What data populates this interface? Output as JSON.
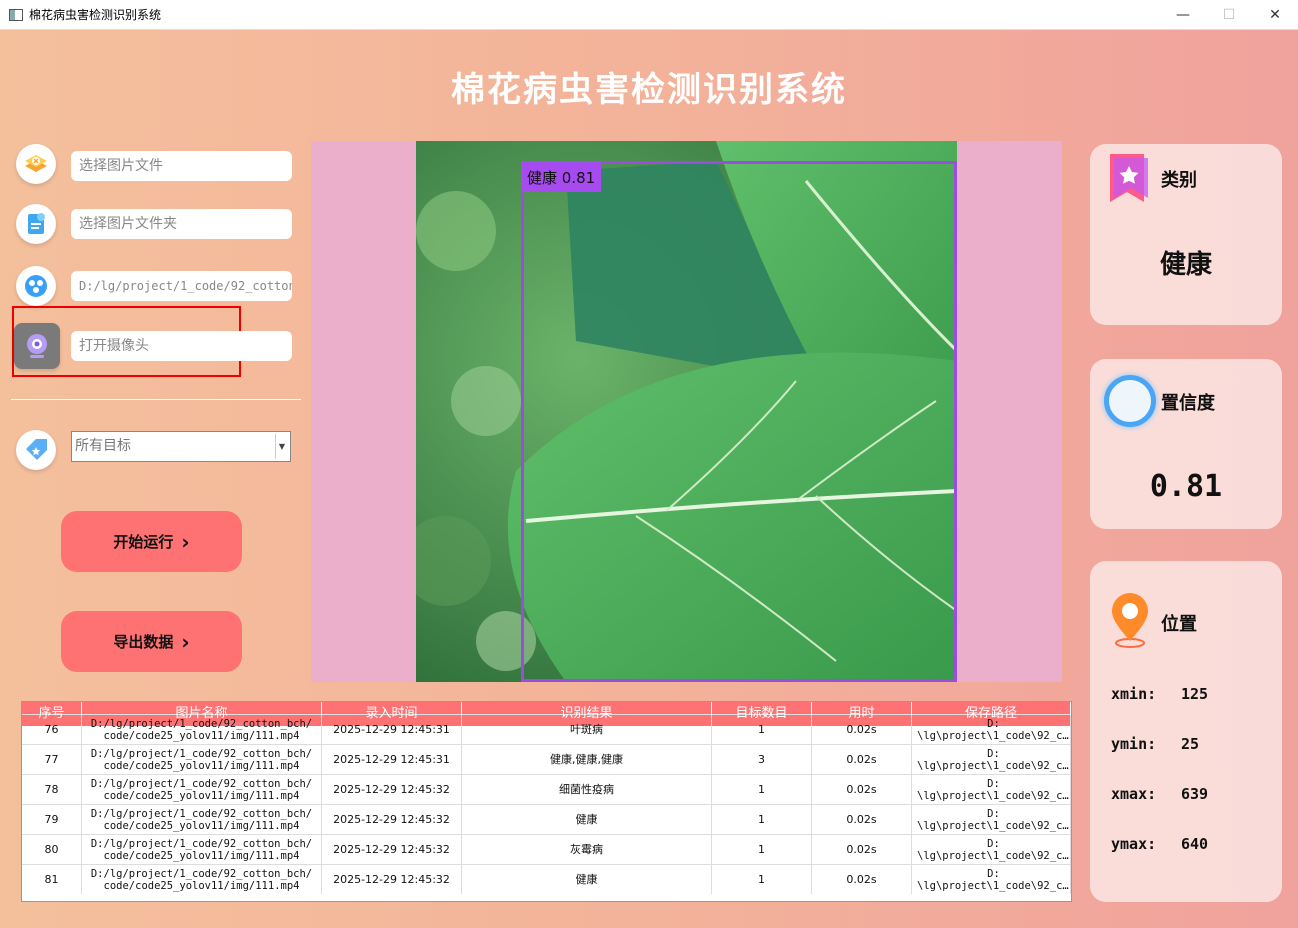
{
  "window": {
    "title": "棉花病虫害检测识别系统",
    "min": "—",
    "max": "☐",
    "close": "✕"
  },
  "app_title": "棉花病虫害检测识别系统",
  "inputs": {
    "image_file": "选择图片文件",
    "image_folder": "选择图片文件夹",
    "video_path": "D:/lg/project/1_code/92_cotton_bch",
    "camera": "打开摄像头"
  },
  "target_select": {
    "value": "所有目标"
  },
  "buttons": {
    "start": "开始运行",
    "export": "导出数据",
    "chevron": "›"
  },
  "detection": {
    "label": "健康 0.81"
  },
  "cards": {
    "category": {
      "title": "类别",
      "value": "健康"
    },
    "confidence": {
      "title": "置信度",
      "value": "0.81"
    },
    "location": {
      "title": "位置",
      "xmin_label": "xmin:",
      "xmin": "125",
      "ymin_label": "ymin:",
      "ymin": "25",
      "xmax_label": "xmax:",
      "xmax": "639",
      "ymax_label": "ymax:",
      "ymax": "640"
    }
  },
  "table": {
    "headers": [
      "序号",
      "图片名称",
      "录入时间",
      "识别结果",
      "目标数目",
      "用时",
      "保存路径"
    ],
    "rows": [
      {
        "id": "76",
        "name1": "D:/lg/project/1_code/92_cotton_bch/",
        "name2": "code/code25_yolov11/img/111.mp4",
        "time": "2025-12-29 12:45:31",
        "result": "叶斑病",
        "count": "1",
        "elapsed": "0.02s",
        "save1": "D:",
        "save2": "\\lg\\project\\1_code\\92_c…"
      },
      {
        "id": "77",
        "name1": "D:/lg/project/1_code/92_cotton_bch/",
        "name2": "code/code25_yolov11/img/111.mp4",
        "time": "2025-12-29 12:45:31",
        "result": "健康,健康,健康",
        "count": "3",
        "elapsed": "0.02s",
        "save1": "D:",
        "save2": "\\lg\\project\\1_code\\92_c…"
      },
      {
        "id": "78",
        "name1": "D:/lg/project/1_code/92_cotton_bch/",
        "name2": "code/code25_yolov11/img/111.mp4",
        "time": "2025-12-29 12:45:32",
        "result": "细菌性疫病",
        "count": "1",
        "elapsed": "0.02s",
        "save1": "D:",
        "save2": "\\lg\\project\\1_code\\92_c…"
      },
      {
        "id": "79",
        "name1": "D:/lg/project/1_code/92_cotton_bch/",
        "name2": "code/code25_yolov11/img/111.mp4",
        "time": "2025-12-29 12:45:32",
        "result": "健康",
        "count": "1",
        "elapsed": "0.02s",
        "save1": "D:",
        "save2": "\\lg\\project\\1_code\\92_c…"
      },
      {
        "id": "80",
        "name1": "D:/lg/project/1_code/92_cotton_bch/",
        "name2": "code/code25_yolov11/img/111.mp4",
        "time": "2025-12-29 12:45:32",
        "result": "灰霉病",
        "count": "1",
        "elapsed": "0.02s",
        "save1": "D:",
        "save2": "\\lg\\project\\1_code\\92_c…"
      },
      {
        "id": "81",
        "name1": "D:/lg/project/1_code/92_cotton_bch/",
        "name2": "code/code25_yolov11/img/111.mp4",
        "time": "2025-12-29 12:45:32",
        "result": "健康",
        "count": "1",
        "elapsed": "0.02s",
        "save1": "D:",
        "save2": "\\lg\\project\\1_code\\92_c…"
      }
    ]
  },
  "colors": {
    "accent": "#ff7273",
    "viewer_bg": "#ecafcb",
    "detection_box": "#9b4dde"
  }
}
